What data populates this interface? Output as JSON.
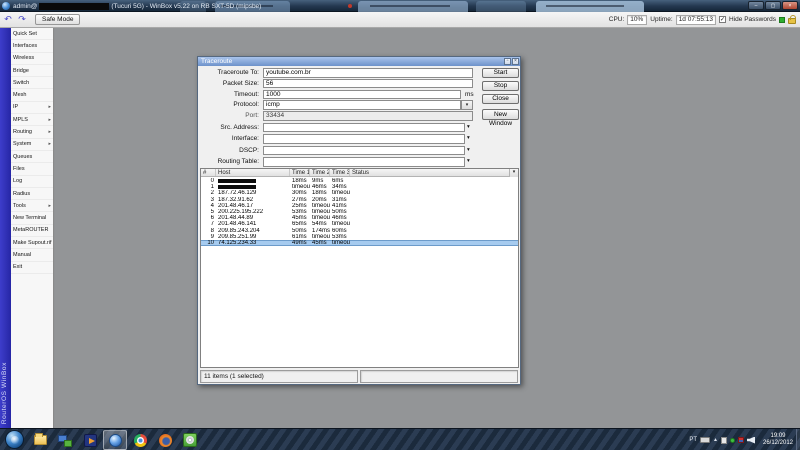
{
  "glyphs": {
    "undo": "↶",
    "redo": "↷",
    "submenu_arrow": "▸",
    "dropdown_arrow": "▾",
    "check": "✓",
    "minimize": "–",
    "maximize": "▢",
    "close": "×",
    "dlg_minimize": "▫",
    "dlg_close": "×",
    "tray_expand": "▲"
  },
  "titlebar": {
    "title_prefix": "admin@",
    "title_suffix": " (Tucuri 5G) - WinBox v5.22 on RB SXT-5D (mipsbe)"
  },
  "toolbar": {
    "safe_mode_label": "Safe Mode",
    "cpu_label": "CPU:",
    "cpu_value": "10%",
    "uptime_label": "Uptime:",
    "uptime_value": "1d 07:55:13",
    "hide_passwords_label": "Hide Passwords"
  },
  "sidebar": {
    "brand": "RouterOS WinBox",
    "items": [
      {
        "label": "Quick Set",
        "submenu": false
      },
      {
        "label": "Interfaces",
        "submenu": false
      },
      {
        "label": "Wireless",
        "submenu": false
      },
      {
        "label": "Bridge",
        "submenu": false
      },
      {
        "label": "Switch",
        "submenu": false
      },
      {
        "label": "Mesh",
        "submenu": false
      },
      {
        "label": "IP",
        "submenu": true
      },
      {
        "label": "MPLS",
        "submenu": true
      },
      {
        "label": "Routing",
        "submenu": true
      },
      {
        "label": "System",
        "submenu": true
      },
      {
        "label": "Queues",
        "submenu": false
      },
      {
        "label": "Files",
        "submenu": false
      },
      {
        "label": "Log",
        "submenu": false
      },
      {
        "label": "Radius",
        "submenu": false
      },
      {
        "label": "Tools",
        "submenu": true
      },
      {
        "label": "New Terminal",
        "submenu": false
      },
      {
        "label": "MetaROUTER",
        "submenu": false
      },
      {
        "label": "Make Supout.rif",
        "submenu": false
      },
      {
        "label": "Manual",
        "submenu": false
      },
      {
        "label": "Exit",
        "submenu": false
      }
    ]
  },
  "traceroute": {
    "title": "Traceroute",
    "form": {
      "traceroute_to": {
        "label": "Traceroute To:",
        "value": "youtube.com.br"
      },
      "packet_size": {
        "label": "Packet Size:",
        "value": "56"
      },
      "timeout": {
        "label": "Timeout:",
        "value": "1000",
        "unit": "ms"
      },
      "protocol": {
        "label": "Protocol:",
        "value": "icmp"
      },
      "port": {
        "label": "Port:",
        "value": "33434"
      },
      "src_address": {
        "label": "Src. Address:",
        "value": ""
      },
      "interface": {
        "label": "Interface:",
        "value": ""
      },
      "dscp": {
        "label": "DSCP:",
        "value": ""
      },
      "routing_table": {
        "label": "Routing Table:",
        "value": ""
      }
    },
    "buttons": {
      "start": "Start",
      "stop": "Stop",
      "close": "Close",
      "new_window": "New Window"
    },
    "table": {
      "columns": [
        "#",
        "Host",
        "Time 1",
        "Time 2",
        "Time 3",
        "Status"
      ],
      "rows": [
        {
          "n": "0",
          "host": "",
          "redacted": true,
          "t1": "18ms",
          "t2": "9ms",
          "t3": "6ms",
          "status": ""
        },
        {
          "n": "1",
          "host": "",
          "redacted": true,
          "t1": "timeout",
          "t2": "46ms",
          "t3": "34ms",
          "status": ""
        },
        {
          "n": "2",
          "host": "187.72.46.129",
          "redacted": false,
          "t1": "30ms",
          "t2": "18ms",
          "t3": "timeout",
          "status": ""
        },
        {
          "n": "3",
          "host": "187.32.91.62",
          "redacted": false,
          "t1": "27ms",
          "t2": "20ms",
          "t3": "31ms",
          "status": ""
        },
        {
          "n": "4",
          "host": "201.48.46.17",
          "redacted": false,
          "t1": "25ms",
          "t2": "timeout",
          "t3": "41ms",
          "status": ""
        },
        {
          "n": "5",
          "host": "200.225.195.222",
          "redacted": false,
          "t1": "53ms",
          "t2": "timeout",
          "t3": "50ms",
          "status": ""
        },
        {
          "n": "6",
          "host": "201.48.44.89",
          "redacted": false,
          "t1": "45ms",
          "t2": "timeout",
          "t3": "46ms",
          "status": ""
        },
        {
          "n": "7",
          "host": "201.48.46.141",
          "redacted": false,
          "t1": "65ms",
          "t2": "54ms",
          "t3": "timeout",
          "status": ""
        },
        {
          "n": "8",
          "host": "209.85.243.204",
          "redacted": false,
          "t1": "50ms",
          "t2": "174ms",
          "t3": "60ms",
          "status": ""
        },
        {
          "n": "9",
          "host": "209.85.251.99",
          "redacted": false,
          "t1": "61ms",
          "t2": "timeout",
          "t3": "53ms",
          "status": ""
        },
        {
          "n": "10",
          "host": "74.125.234.33",
          "redacted": false,
          "t1": "49ms",
          "t2": "45ms",
          "t3": "timeout",
          "status": "",
          "selected": true
        }
      ],
      "status_text": "11 items (1 selected)"
    }
  },
  "taskbar": {
    "language": "PT",
    "clock_time": "19:09",
    "clock_date": "26/12/2012"
  },
  "colors": {
    "selected_row": "#a6cbef",
    "brand_strip": "#2e2eb5",
    "dialog_caption": "#7d9fd4",
    "status_led": "#2fae2f"
  }
}
